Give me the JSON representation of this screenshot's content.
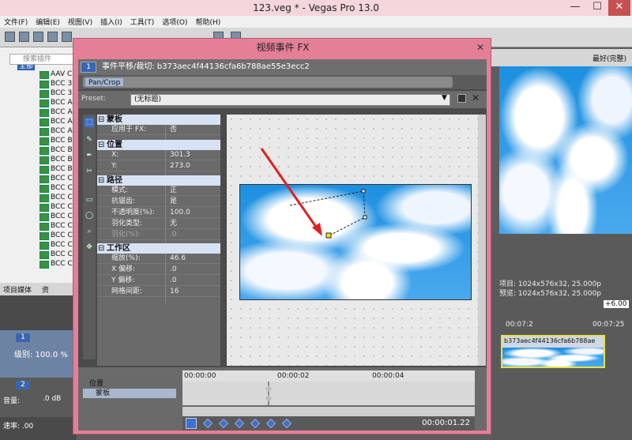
{
  "app": {
    "title": "123.veg * - Vegas Pro 13.0",
    "win_min": "—",
    "win_max": "☐",
    "win_close": "✕"
  },
  "menu": [
    "文件(F)",
    "编辑(E)",
    "视图(V)",
    "插入(I)",
    "工具(T)",
    "选项(O)",
    "帮助(H)"
  ],
  "explorer": {
    "search_placeholder": "搜索插件",
    "root": "全部",
    "items": [
      "AAV C",
      "BCC 3",
      "BCC 3",
      "BCC A",
      "BCC A",
      "BCC A",
      "BCC A",
      "BCC B",
      "BCC B",
      "BCC B",
      "BCC B",
      "BCC C",
      "BCC C",
      "BCC C",
      "BCC C",
      "BCC C",
      "BCC C",
      "BCC C",
      "BCC C",
      "BCC C",
      "BCC C"
    ],
    "tab": "项目媒体",
    "tab2": "资"
  },
  "tracks": {
    "t1_num": "1",
    "level": "级别: 100.0 %",
    "t2_num": "2",
    "volume": "音量:",
    "db": ".0 dB",
    "speed": "速率: .00"
  },
  "preview": {
    "quality": "最好(完整)",
    "project": "项目: 1024x576x32, 25.000p",
    "preview": "预览: 1024x576x32, 25.000p",
    "offset": "+6.00",
    "t1": "00:07:2",
    "t2": "00:07:25",
    "event": "b373aec4f44136cfa6b788ae"
  },
  "dialog": {
    "title": "视频事件 FX",
    "close": "✕",
    "num": "1",
    "header": "事件平移/裁切: b373aec4f44136cfa6b788ae55e3ecc2",
    "plugin": "Pan/Crop",
    "preset_label": "Preset:",
    "preset_value": "(无标题)",
    "sections": {
      "mask": {
        "title": "蒙板",
        "rows": [
          {
            "k": "应用于 FX:",
            "v": "否"
          }
        ]
      },
      "position": {
        "title": "位置",
        "rows": [
          {
            "k": "X:",
            "v": "301.3"
          },
          {
            "k": "Y:",
            "v": "273.0"
          }
        ]
      },
      "path": {
        "title": "路径",
        "rows": [
          {
            "k": "模式:",
            "v": "正"
          },
          {
            "k": "抗锯齿:",
            "v": "是"
          },
          {
            "k": "不透明度(%):",
            "v": "100.0"
          },
          {
            "k": "羽化类型:",
            "v": "无"
          },
          {
            "k": "羽化(%):",
            "v": ".0"
          }
        ]
      },
      "workspace": {
        "title": "工作区",
        "rows": [
          {
            "k": "缩放(%):",
            "v": "46.6"
          },
          {
            "k": "X 偏移:",
            "v": ".0"
          },
          {
            "k": "Y 偏移:",
            "v": ".0"
          },
          {
            "k": "网格间距:",
            "v": "16"
          }
        ]
      }
    },
    "keyframes": {
      "labels": [
        "位置",
        "蒙板"
      ],
      "times": [
        "00:00:00",
        "00:00:02",
        "00:00:04"
      ],
      "timecode": "00:00:01.22"
    }
  }
}
